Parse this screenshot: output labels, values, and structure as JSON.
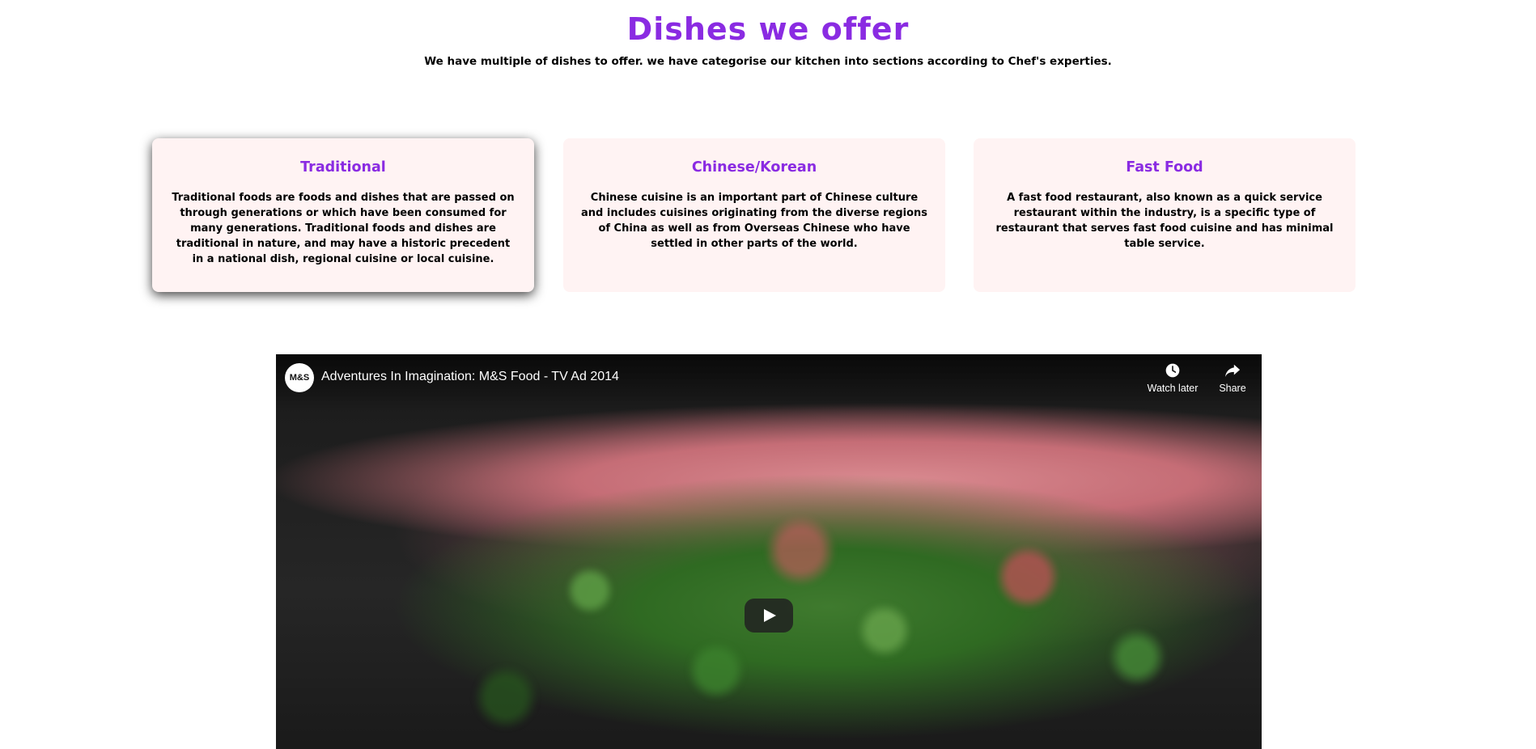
{
  "header": {
    "title": "Dishes we offer",
    "subtitle": "We have multiple of dishes to offer. we have categorise our kitchen into sections according to Chef's experties."
  },
  "colors": {
    "accent": "#8a2be2",
    "card_background": "#fff3f3"
  },
  "cards": [
    {
      "title": "Traditional",
      "text": "Traditional foods are foods and dishes that are passed on through generations or which have been consumed for many generations. Traditional foods and dishes are traditional in nature, and may have a historic precedent in a national dish, regional cuisine or local cuisine."
    },
    {
      "title": "Chinese/Korean",
      "text": "Chinese cuisine is an important part of Chinese culture and includes cuisines originating from the diverse regions of China as well as from Overseas Chinese who have settled in other parts of the world."
    },
    {
      "title": "Fast Food",
      "text": "A fast food restaurant, also known as a quick service restaurant within the industry, is a specific type of restaurant that serves fast food cuisine and has minimal table service."
    }
  ],
  "video": {
    "channel_logo_text": "M&S",
    "title": "Adventures In Imagination: M&S Food - TV Ad 2014",
    "watch_later_label": "Watch later",
    "share_label": "Share",
    "play_icon": "play-icon",
    "watch_later_icon": "clock-icon",
    "share_icon": "share-icon"
  }
}
